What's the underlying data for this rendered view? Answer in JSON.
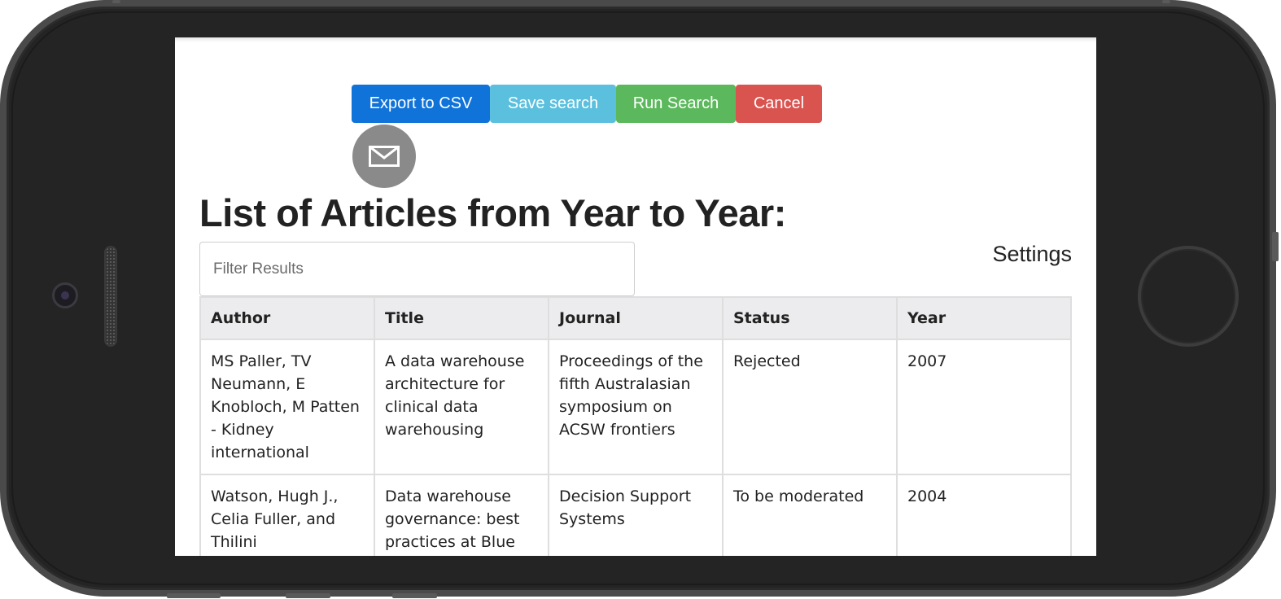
{
  "toolbar": {
    "export_label": "Export to CSV",
    "save_label": "Save search",
    "run_label": "Run Search",
    "cancel_label": "Cancel",
    "mail_icon": "envelope-icon"
  },
  "page": {
    "title": "List of Articles from Year to Year:",
    "settings_label": "Settings"
  },
  "filter": {
    "placeholder": "Filter Results",
    "value": ""
  },
  "table": {
    "headers": [
      "Author",
      "Title",
      "Journal",
      "Status",
      "Year"
    ],
    "rows": [
      [
        "MS Paller, TV Neumann, E Knobloch, M Patten - Kidney international",
        "A data warehouse architecture for clinical data warehousing",
        "Proceedings of the fifth Australasian symposium on ACSW frontiers",
        "Rejected",
        "2007"
      ],
      [
        "Watson, Hugh J., Celia Fuller, and Thilini Ariyachandra",
        "Data warehouse governance: best practices at Blue Cross and Blue Shield",
        "Decision Support Systems",
        "To be moderated",
        "2004"
      ]
    ]
  },
  "colors": {
    "primary": "#0f73d9",
    "info": "#5bc0de",
    "success": "#5cb85c",
    "danger": "#d9534f",
    "mail_button": "#8a8a8a",
    "table_header_bg": "#ececee",
    "device_frame": "#242424"
  }
}
